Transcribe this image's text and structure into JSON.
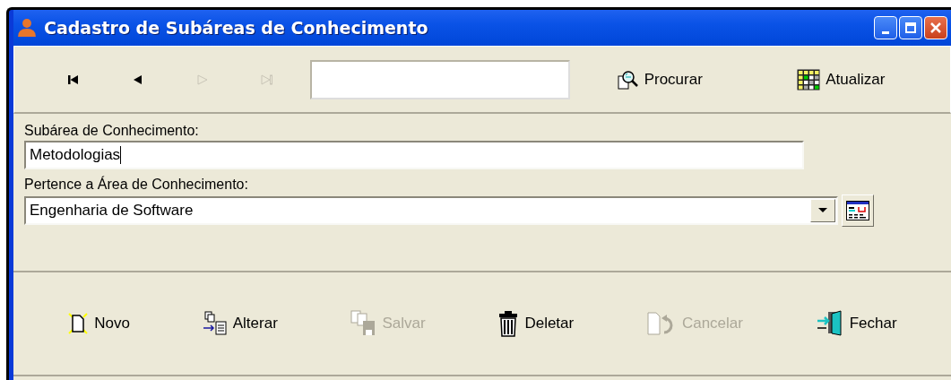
{
  "window": {
    "title": "Cadastro de Subáreas de Conhecimento"
  },
  "navigator": {
    "buttons": [
      {
        "kind": "first",
        "disabled": false
      },
      {
        "kind": "prior",
        "disabled": false
      },
      {
        "kind": "next",
        "disabled": true
      },
      {
        "kind": "last",
        "disabled": true
      }
    ],
    "actions": [
      {
        "kind": "search",
        "label": "Procurar",
        "disabled": false
      },
      {
        "kind": "refresh",
        "label": "Atualizar",
        "disabled": false
      }
    ]
  },
  "form": {
    "fields": [
      {
        "kind": "text",
        "label": "Subárea de Conhecimento:",
        "value": "Metodologias",
        "focused": true
      },
      {
        "kind": "combo",
        "label": "Pertence a Área de Conhecimento:",
        "value": "Engenharia de Software",
        "focused": false
      }
    ]
  },
  "buttons": [
    {
      "kind": "new",
      "label": "Novo",
      "disabled": false
    },
    {
      "kind": "edit",
      "label": "Alterar",
      "disabled": false
    },
    {
      "kind": "save",
      "label": "Salvar",
      "disabled": true
    },
    {
      "kind": "delete",
      "label": "Deletar",
      "disabled": false
    },
    {
      "kind": "cancel",
      "label": "Cancelar",
      "disabled": true
    },
    {
      "kind": "close",
      "label": "Fechar",
      "disabled": false
    }
  ]
}
